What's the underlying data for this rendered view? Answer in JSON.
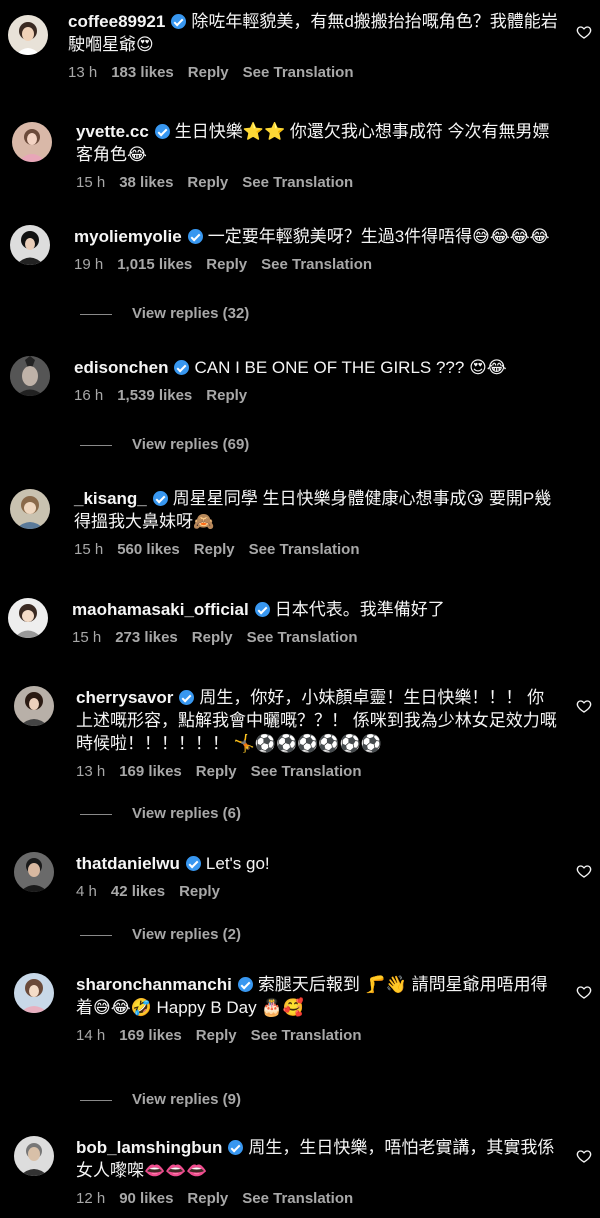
{
  "comments": [
    {
      "username": "coffee89921",
      "verified": true,
      "text": "除咗年輕貌美，有無d搬搬抬抬嘅角色？我體能岩駛嗰星爺😍",
      "time": "13 h",
      "likes": "183 likes",
      "reply": "Reply",
      "translate": "See Translation",
      "heart": true
    },
    {
      "username": "yvette.cc",
      "verified": true,
      "text": "生日快樂⭐⭐ 你還欠我心想事成符 今次有無男嫖客角色😂",
      "time": "15 h",
      "likes": "38 likes",
      "reply": "Reply",
      "translate": "See Translation",
      "heart": false
    },
    {
      "username": "myoliemyolie",
      "verified": true,
      "text": "一定要年輕貌美呀？生過3件得唔得😅😂😂😂",
      "time": "19 h",
      "likes": "1,015 likes",
      "reply": "Reply",
      "translate": "See Translation",
      "heart": false,
      "view_replies": "View replies (32)"
    },
    {
      "username": "edisonchen",
      "verified": true,
      "text": "CAN I BE ONE OF THE GIRLS ??? 😍😂",
      "time": "16 h",
      "likes": "1,539 likes",
      "reply": "Reply",
      "translate": "",
      "heart": false,
      "view_replies": "View replies (69)"
    },
    {
      "username": "_kisang_",
      "verified": true,
      "text": "周星星同學 生日快樂身體健康心想事成😘 要開P幾得搵我大鼻妹呀🙈",
      "time": "15 h",
      "likes": "560 likes",
      "reply": "Reply",
      "translate": "See Translation",
      "heart": false
    },
    {
      "username": "maohamasaki_official",
      "verified": true,
      "text": "日本代表。我準備好了",
      "time": "15 h",
      "likes": "273 likes",
      "reply": "Reply",
      "translate": "See Translation",
      "heart": false
    },
    {
      "username": "cherrysavor",
      "verified": true,
      "text": "周生，你好，小妹顏卓靈！生日快樂！！！ 你上述嘅形容，點解我會中曬嘅？？！ 係咪到我為少林女足效力嘅時候啦！！！！！！ 🤸⚽⚽⚽⚽⚽⚽",
      "time": "13 h",
      "likes": "169 likes",
      "reply": "Reply",
      "translate": "See Translation",
      "heart": true,
      "view_replies": "View replies (6)"
    },
    {
      "username": "thatdanielwu",
      "verified": true,
      "text": "Let's go!",
      "time": "4 h",
      "likes": "42 likes",
      "reply": "Reply",
      "translate": "",
      "heart": true,
      "view_replies": "View replies (2)"
    },
    {
      "username": "sharonchanmanchi",
      "verified": true,
      "text": "索腿天后報到 🦵👋 請問星爺用唔用得着😅😂🤣 Happy B Day 🎂🥰",
      "time": "14 h",
      "likes": "169 likes",
      "reply": "Reply",
      "translate": "See Translation",
      "heart": true,
      "view_replies": "View replies (9)"
    },
    {
      "username": "bob_lamshingbun",
      "verified": true,
      "text": "周生，生日快樂，唔怕老實講，其實我係女人嚟㗎👄👄👄",
      "time": "12 h",
      "likes": "90 likes",
      "reply": "Reply",
      "translate": "See Translation",
      "heart": true
    }
  ],
  "colors": {
    "background": "#000000",
    "text": "#f5f5f5",
    "muted": "#a8a8a8",
    "verified": "#3897f0"
  },
  "icons": {
    "heart": "heart-outline-icon",
    "verified": "verified-badge-icon"
  }
}
